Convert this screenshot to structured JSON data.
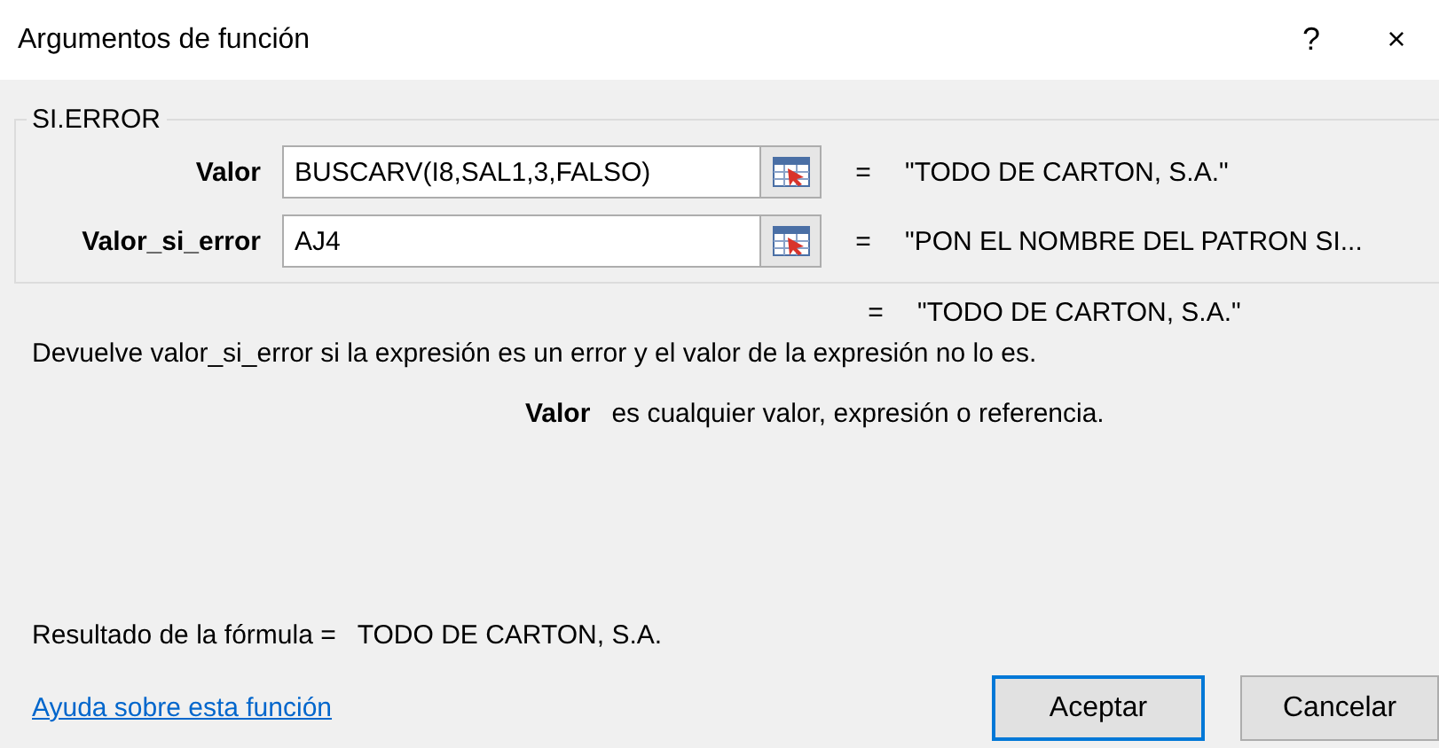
{
  "window": {
    "title": "Argumentos de función",
    "help": "?",
    "close": "×"
  },
  "group": {
    "title": "SI.ERROR",
    "arguments": [
      {
        "label": "Valor",
        "value": "BUSCARV(I8,SAL1,3,FALSO)",
        "equals": "=",
        "result": "\"TODO DE CARTON, S.A.\""
      },
      {
        "label": "Valor_si_error",
        "value": "AJ4",
        "equals": "=",
        "result": "\"PON EL NOMBRE DEL PATRON SI..."
      }
    ]
  },
  "function_result": {
    "equals": "=",
    "value": "\"TODO DE CARTON, S.A.\""
  },
  "description": "Devuelve valor_si_error si la expresión es un error y el valor de la expresión no lo es.",
  "argument_help": {
    "name": "Valor",
    "text": "es cualquier valor, expresión o referencia."
  },
  "formula_result": {
    "label": "Resultado de la fórmula =",
    "value": "TODO DE CARTON, S.A."
  },
  "help_link": "Ayuda sobre esta función",
  "buttons": [
    {
      "label": "Aceptar",
      "default": true
    },
    {
      "label": "Cancelar",
      "default": false
    }
  ]
}
